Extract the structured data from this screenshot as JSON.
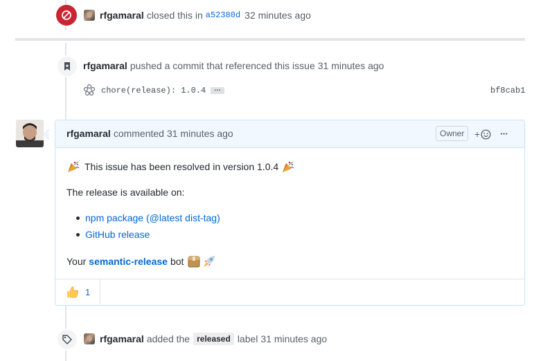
{
  "closed_event": {
    "author": "rfgamaral",
    "action": "closed this in",
    "commit_ref": "a52380d",
    "time": "32 minutes ago",
    "status_color": "#cb2431"
  },
  "push_event": {
    "author": "rfgamaral",
    "action": "pushed a commit that referenced this issue",
    "time": "31 minutes ago",
    "commit_message": "chore(release): 1.0.4",
    "ellipsis_label": "…",
    "commit_sha": "bf8cab1"
  },
  "comment": {
    "author": "rfgamaral",
    "action": "commented",
    "time": "31 minutes ago",
    "owner_badge": "Owner",
    "reaction_add_label": "+",
    "more_label": "···",
    "resolved_line": "This issue has been resolved in version 1.0.4",
    "available_line": "The release is available on:",
    "links": [
      "npm package (@latest dist-tag)",
      "GitHub release"
    ],
    "signoff_prefix": "Your",
    "signoff_link": "semantic-release",
    "signoff_suffix": "bot",
    "reaction_count": "1"
  },
  "label_event": {
    "author": "rfgamaral",
    "action": "added the",
    "label": "released",
    "suffix": "label",
    "time": "31 minutes ago"
  },
  "icons": {
    "closed": "circle-slash-icon",
    "push": "bookmark-icon",
    "commit": "cube-icon",
    "label": "tag-icon",
    "emoji": "smiley-icon",
    "tada": "party-popper-icon",
    "package": "package-icon",
    "rocket": "rocket-icon",
    "thumbs_up": "thumbs-up-icon"
  },
  "colors": {
    "link": "#0366d6",
    "comment_border": "#c8e1ff",
    "comment_header_bg": "#f1f8ff",
    "timeline": "#e1e4e8"
  }
}
